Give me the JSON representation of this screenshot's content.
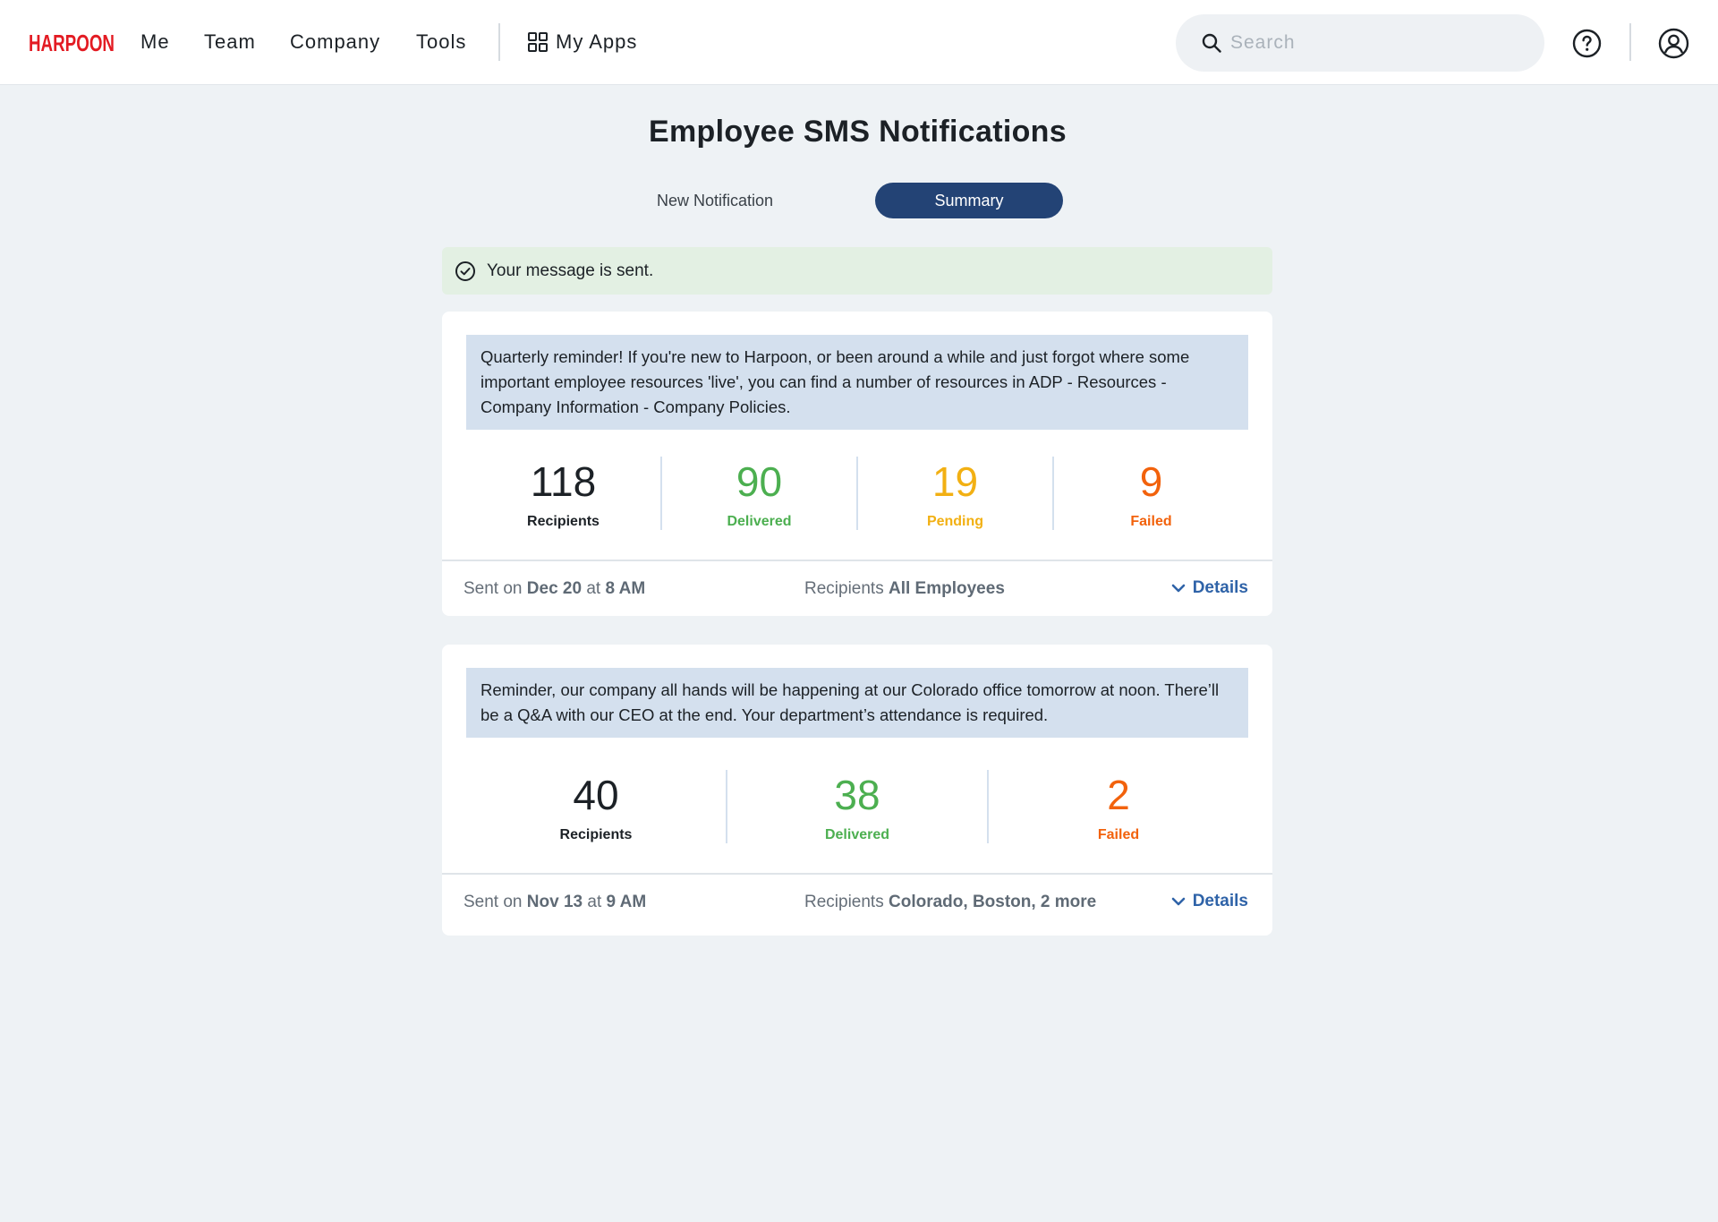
{
  "header": {
    "logo_text": "HARPOON",
    "nav": [
      "Me",
      "Team",
      "Company",
      "Tools"
    ],
    "my_apps": "My Apps",
    "search_placeholder": "Search"
  },
  "page": {
    "title": "Employee SMS Notifications",
    "tabs": {
      "new": "New Notification",
      "summary": "Summary"
    },
    "alert": "Your message is sent."
  },
  "cards": [
    {
      "message": "Quarterly reminder! If you're new to Harpoon, or been around a while and just forgot where some important employee resources 'live', you can find a number of resources in ADP - Resources - Company Information - Company Policies.",
      "stats": [
        {
          "value": "118",
          "label": "Recipients"
        },
        {
          "value": "90",
          "label": "Delivered"
        },
        {
          "value": "19",
          "label": "Pending"
        },
        {
          "value": "9",
          "label": "Failed"
        }
      ],
      "sent_prefix": "Sent on",
      "sent_date": "Dec 20",
      "sent_at": "at",
      "sent_time": "8 AM",
      "recipients_prefix": "Recipients",
      "recipients": "All Employees",
      "details": "Details"
    },
    {
      "message": "Reminder, our company all hands will be happening at our Colorado office tomorrow at noon. There’ll be a Q&A with our CEO at the end. Your department’s attendance is required.",
      "stats": [
        {
          "value": "40",
          "label": "Recipients"
        },
        {
          "value": "38",
          "label": "Delivered"
        },
        {
          "value": "2",
          "label": "Failed"
        }
      ],
      "sent_prefix": "Sent on",
      "sent_date": "Nov 13",
      "sent_at": "at",
      "sent_time": "9 AM",
      "recipients_prefix": "Recipients",
      "recipients": "Colorado, Boston, 2 more",
      "details": "Details"
    }
  ],
  "colors": {
    "brand_red": "#e31b23",
    "primary_navy": "#234375",
    "delivered": "#4caf50",
    "pending": "#f2b013",
    "failed": "#f2620c",
    "link_blue": "#2f63a8",
    "alert_bg": "#e3f0e3",
    "message_bg": "#d4e0ee"
  },
  "icons": {
    "search": "search-icon",
    "apps": "grid-icon",
    "help": "help-circle-icon",
    "profile": "user-circle-icon",
    "alert": "check-circle-icon",
    "details": "chevron-down-icon"
  }
}
